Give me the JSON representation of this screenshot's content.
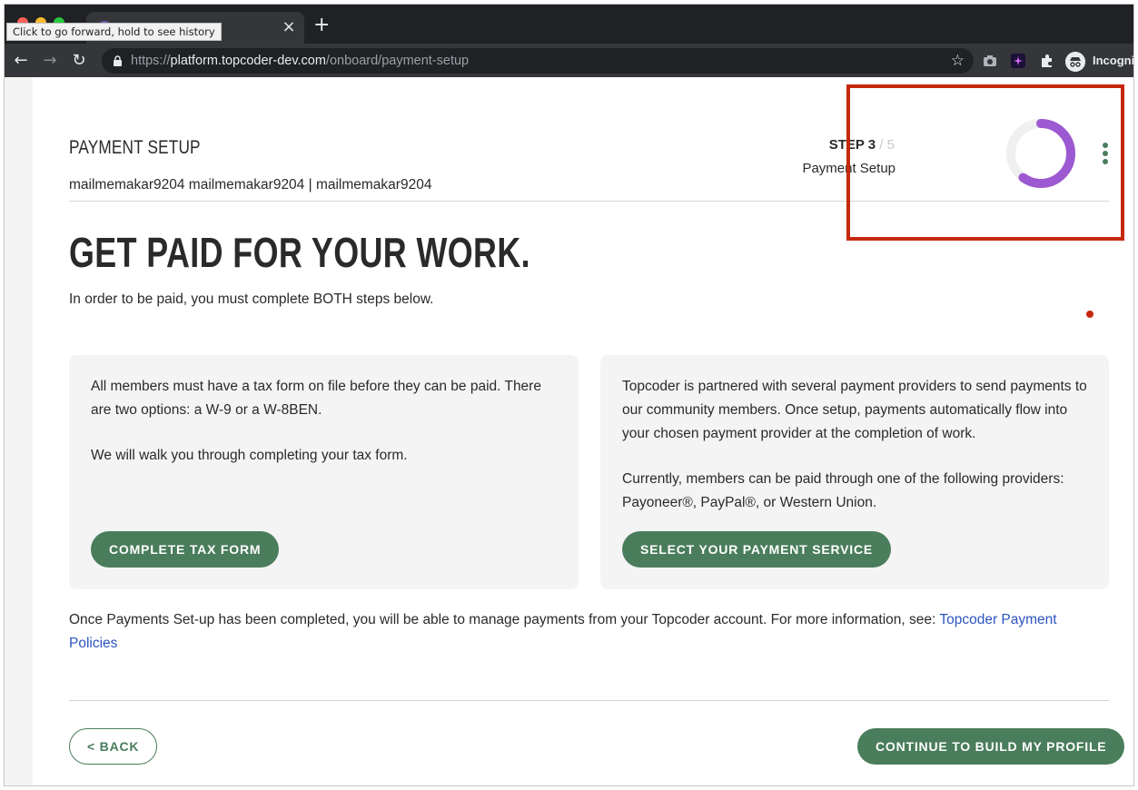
{
  "browser": {
    "tooltip": "Click to go forward, hold to see history",
    "tab_close": "×",
    "new_tab": "+",
    "back_icon": "←",
    "forward_icon": "→",
    "reload_icon": "↻",
    "url_scheme": "https://",
    "url_host": "platform.topcoder-dev.com",
    "url_path": "/onboard/payment-setup",
    "bookmark_icon": "☆",
    "profile_label": "Incogni"
  },
  "header": {
    "section_label": "PAYMENT SETUP",
    "user_line": "mailmemakar9204 mailmemakar9204 | mailmemakar9204"
  },
  "progress": {
    "step_prefix": "STEP 3",
    "step_total": " / 5",
    "step_name": "Payment Setup",
    "fraction": 0.6,
    "ring_color": "#9c59d1",
    "track_color": "#f0f0f0"
  },
  "main": {
    "headline": "GET PAID FOR YOUR WORK.",
    "intro": "In order to be paid, you must complete BOTH steps below."
  },
  "panels": {
    "tax": {
      "p1": "All members must have a tax form on file before they can be paid. There are two options: a W-9 or a W-8BEN.",
      "p2": "We will walk you through completing your tax form.",
      "button": "COMPLETE TAX FORM"
    },
    "payment": {
      "p1": "Topcoder is partnered with several payment providers to send payments to our community members. Once setup, payments automatically flow into your chosen payment provider at the completion of work.",
      "p2": "Currently, members can be paid through one of the following providers: Payoneer®, PayPal®, or Western Union.",
      "button": "SELECT YOUR PAYMENT SERVICE"
    }
  },
  "footer": {
    "note": "Once Payments Set-up has been completed, you will be able to manage payments from your Topcoder account. For more information, see: ",
    "link": "Topcoder Payment Policies",
    "back_button": "< BACK",
    "continue_button": "CONTINUE TO BUILD MY PROFILE"
  },
  "colors": {
    "brand_green": "#4a7d5b",
    "highlight_red": "#c5280c",
    "link_blue": "#2c54c0"
  }
}
